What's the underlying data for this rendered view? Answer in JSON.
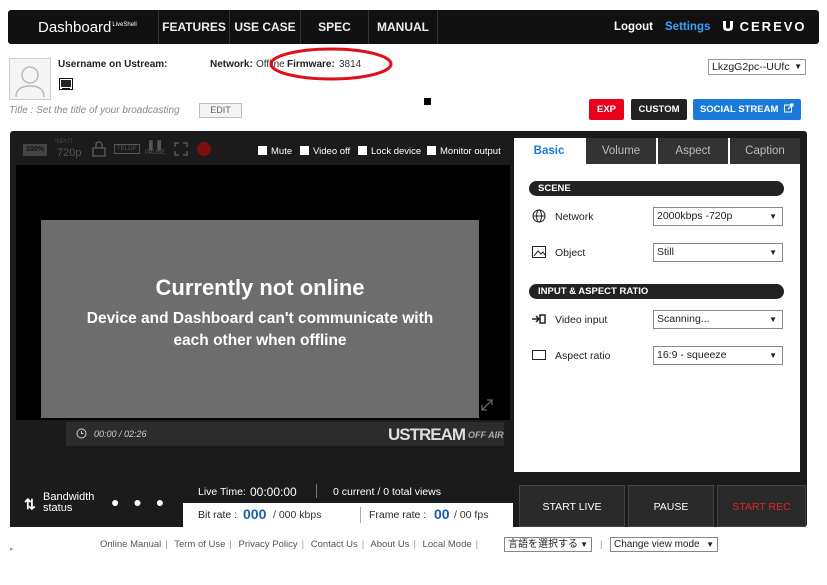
{
  "nav": {
    "logo": "Dashboard",
    "logo_sup": "LiveShell",
    "items": [
      {
        "label": "FEATURES"
      },
      {
        "label": "USE CASE"
      },
      {
        "label": "SPEC"
      },
      {
        "label": "MANUAL"
      }
    ],
    "logout": "Logout",
    "settings": "Settings",
    "brand": "CEREVO"
  },
  "user": {
    "username_label": "Username on Ustream:",
    "network_label": "Network:",
    "network_value": "Offline",
    "firmware_label": "Firmware:",
    "firmware_value": "3814",
    "title_label": "Title :",
    "title_placeholder": "Set the title of your broadcasting",
    "edit_label": "EDIT",
    "channel_value": "LkzgG2pc--UUfc"
  },
  "top_buttons": {
    "exp": "EXP",
    "custom": "CUSTOM",
    "social": "SOCIAL STREAM"
  },
  "video_toolbar": {
    "zoom": "100%",
    "input_label": "INPUT",
    "input_value": "720p",
    "telop": "TELOP",
    "pause": "PAUSE",
    "checkboxes": [
      {
        "label": "Mute"
      },
      {
        "label": "Video off"
      },
      {
        "label": "Lock device"
      },
      {
        "label": "Monitor output"
      }
    ]
  },
  "offline": {
    "title": "Currently not online",
    "line1": "Device and Dashboard can't communicate with",
    "line2": "each other when offline"
  },
  "player": {
    "time": "00:00 / 02:26",
    "brand": "USTREAM",
    "status": "OFF AIR"
  },
  "tabs": [
    {
      "label": "Basic"
    },
    {
      "label": "Volume"
    },
    {
      "label": "Aspect"
    },
    {
      "label": "Caption"
    }
  ],
  "scene": {
    "heading": "SCENE",
    "rows": [
      {
        "label": "Network",
        "value": "2000kbps -720p",
        "icon": "globe-icon"
      },
      {
        "label": "Object",
        "value": "Still",
        "icon": "image-icon"
      }
    ]
  },
  "input_aspect": {
    "heading": "INPUT & ASPECT RATIO",
    "rows": [
      {
        "label": "Video input",
        "value": "Scanning...",
        "icon": "input-icon"
      },
      {
        "label": "Aspect ratio",
        "value": "16:9 - squeeze",
        "icon": "aspect-icon"
      }
    ]
  },
  "bandwidth": {
    "label1": "Bandwidth",
    "label2": "status",
    "dots": "● ● ●"
  },
  "stats": {
    "live_time_label": "Live Time:",
    "live_time_value": "00:00:00",
    "views": "0 current / 0 total views",
    "bitrate_label": "Bit rate :",
    "bitrate_value": "000",
    "bitrate_unit": "/ 000 kbps",
    "framerate_label": "Frame rate :",
    "framerate_value": "00",
    "framerate_unit": "/ 00 fps"
  },
  "actions": {
    "start_live": "START LIVE",
    "pause": "PAUSE",
    "start_rec": "START REC"
  },
  "footer": {
    "links": [
      "Online Manual",
      "Term of Use",
      "Privacy Policy",
      "Contact Us",
      "About Us",
      "Local Mode"
    ],
    "language": "言語を選択する",
    "view_mode": "Change view mode"
  },
  "colors": {
    "accent_blue": "#1a7ad8",
    "exp_red": "#e8001c",
    "rec_red": "#e0202a",
    "annotation_red": "#e0101a"
  }
}
